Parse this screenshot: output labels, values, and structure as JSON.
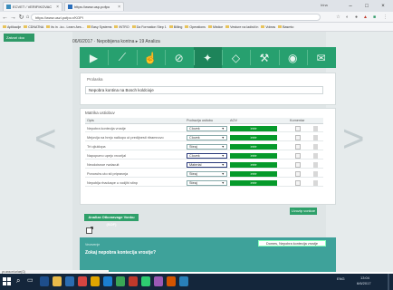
{
  "browser": {
    "tabs": [
      {
        "label": "ECVET / VERIFIKOVAC"
      },
      {
        "label": "https://www.usp.pofpo"
      }
    ],
    "user": "Irina",
    "url": "https://www.uszi.pofpo.r/KOPI",
    "bookmarks": [
      "Aplikacije",
      "CDNATNA",
      "its in ..ko.. Learn Aes...",
      "Easy Systems",
      "INTRO",
      "Da Formation Step 1",
      "Billing",
      "Operations",
      "Mistice",
      "Vesture na ladisti in",
      "Voleas",
      "Basmto"
    ]
  },
  "app": {
    "dash_button": "Zatvori doo",
    "title": "06/6/2017 · Nepobijena kontna ▸ 19 Analiza",
    "steps": [
      "play",
      "chart",
      "hand",
      "link",
      "gear",
      "shield",
      "tools",
      "lock",
      "mail"
    ],
    "panel": {
      "label": "Prolaska",
      "value": "Nepobra kontina na Bosch koldcioje"
    },
    "table": {
      "title": "Matrika ustiobuv",
      "headers": [
        "Opis",
        "Podrazija ustiobu",
        "AOV",
        "Komentar"
      ],
      "rows": [
        {
          "name": "Nepobra kontecija vrostje",
          "select": "Clovek",
          "bar": ">>>"
        },
        {
          "name": "Mejovija na hrejo nalkopo ut predijnesti ritramnovo",
          "select": "Clovek",
          "bar": ">>>"
        },
        {
          "name": "Trt ojiuklopa",
          "select": "Steaj",
          "bar": ">>>"
        },
        {
          "name": "Napopumo upejo vrcorijal",
          "select": "Clovek",
          "bar": ">>>"
        },
        {
          "name": "Neodoisnoe rwdacuit",
          "select": "Material",
          "bar": ">>>"
        },
        {
          "name": "Ponoruhs uto sti pripravnja",
          "select": "Steaj",
          "bar": ">>>"
        },
        {
          "name": "Nepoblja rhaduspe u vodjihi stinp",
          "select": "Steaj",
          "bar": ">>>"
        }
      ]
    },
    "save_button": "Uvozip vonkoe",
    "green_button": "Analiza Otkonavage Vonku (SOF)",
    "question": {
      "small": "Vecevenje",
      "text": "Zokaj nepobra kontecija vrostje?",
      "button": "Domes, Nepobra kontecija vrostje"
    }
  },
  "status_bar": "yo ana m/ur/oe(G)",
  "taskbar": {
    "time": "13:04",
    "date": "6/6/2017",
    "lang": "ENG"
  },
  "colors": {
    "brand_green": "#27a06f",
    "bar_green": "#069a2b",
    "teal_panel": "#3ea29a",
    "taskbar": "#14263b"
  }
}
